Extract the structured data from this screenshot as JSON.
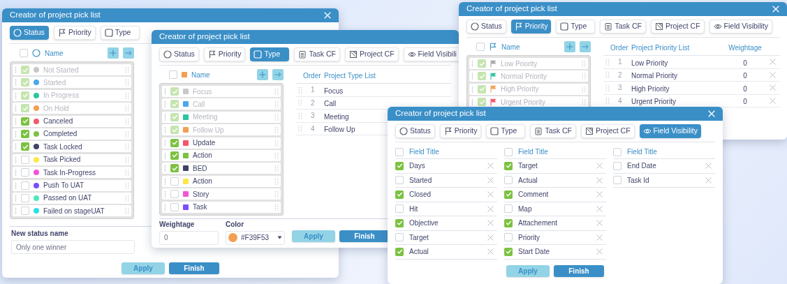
{
  "windows": [
    {
      "kind": "status",
      "title": "Creator of project pick list",
      "closable": true,
      "tabs": [
        {
          "label": "Status",
          "selected": true
        },
        {
          "label": "Priority",
          "selected": false
        },
        {
          "label": "Type",
          "selected": false
        }
      ],
      "list": {
        "all_checked": false,
        "header": "Name",
        "items": [
          {
            "label": "Not Started",
            "color": "#c8c8c8",
            "checked": true,
            "disabled": true
          },
          {
            "label": "Started",
            "color": "#4aa8e8",
            "checked": true,
            "disabled": true
          },
          {
            "label": "In Progress",
            "color": "#2ec4a0",
            "checked": true,
            "disabled": true
          },
          {
            "label": "On Hold",
            "color": "#f39f53",
            "checked": true,
            "disabled": true
          },
          {
            "label": "Canceled",
            "color": "#f5566a",
            "checked": true,
            "disabled": false
          },
          {
            "label": "Completed",
            "color": "#7cc242",
            "checked": true,
            "disabled": false
          },
          {
            "label": "Task Locked",
            "color": "#3f4369",
            "checked": true,
            "disabled": false
          },
          {
            "label": "Task Picked",
            "color": "#fde74c",
            "checked": false,
            "disabled": false
          },
          {
            "label": "Task In-Progress",
            "color": "#f455d6",
            "checked": false,
            "disabled": false
          },
          {
            "label": "Push To UAT",
            "color": "#7c4dff",
            "checked": false,
            "disabled": false
          },
          {
            "label": "Passed on UAT",
            "color": "#4ee8c0",
            "checked": false,
            "disabled": false
          },
          {
            "label": "Failed on stageUAT",
            "color": "#2ee0e0",
            "checked": false,
            "disabled": false
          }
        ]
      },
      "form": [
        {
          "kind": "text",
          "label": "New status name",
          "value": "Only one winner"
        }
      ],
      "buttons": [
        {
          "label": "Apply",
          "kind": "secondary"
        },
        {
          "label": "Finish",
          "kind": "primary"
        }
      ]
    },
    {
      "kind": "type",
      "title": "Creator of project pick list",
      "closable": false,
      "tabs": [
        {
          "label": "Status",
          "selected": false
        },
        {
          "label": "Priority",
          "selected": false
        },
        {
          "label": "Type",
          "selected": true
        },
        {
          "label": "Task CF",
          "selected": false
        },
        {
          "label": "Project CF",
          "selected": false
        },
        {
          "label": "Field Visibili",
          "selected": false
        }
      ],
      "list": {
        "all_checked": false,
        "header": "Name",
        "items": [
          {
            "label": "Focus",
            "color": "#c8c8c8",
            "checked": true,
            "disabled": true
          },
          {
            "label": "Call",
            "color": "#4aa8e8",
            "checked": true,
            "disabled": true
          },
          {
            "label": "Meeting",
            "color": "#2ec4a0",
            "checked": true,
            "disabled": true
          },
          {
            "label": "Follow Up",
            "color": "#f39f53",
            "checked": true,
            "disabled": true
          },
          {
            "label": "Update",
            "color": "#f5566a",
            "checked": true,
            "disabled": false
          },
          {
            "label": "Action",
            "color": "#7cc242",
            "checked": true,
            "disabled": false
          },
          {
            "label": "BED",
            "color": "#3f4369",
            "checked": true,
            "disabled": false
          },
          {
            "label": "Action",
            "color": "#fde74c",
            "checked": false,
            "disabled": false
          },
          {
            "label": "Story",
            "color": "#f455d6",
            "checked": false,
            "disabled": false
          },
          {
            "label": "Task",
            "color": "#7c4dff",
            "checked": false,
            "disabled": false
          }
        ]
      },
      "table": {
        "columns": [
          "Order",
          "Project Type List"
        ],
        "rows": [
          {
            "cells": [
              "1",
              "Focus"
            ]
          },
          {
            "cells": [
              "2",
              "Call"
            ]
          },
          {
            "cells": [
              "3",
              "Meeting"
            ]
          },
          {
            "cells": [
              "4",
              "Follow Up"
            ]
          }
        ]
      },
      "form": [
        {
          "kind": "text",
          "label": "Weightage",
          "value": "0"
        },
        {
          "kind": "color",
          "label": "Color",
          "value": "#F39F53",
          "color": "#f39f53"
        }
      ],
      "buttons": [
        {
          "label": "Apply",
          "kind": "secondary"
        },
        {
          "label": "Finish",
          "kind": "primary"
        }
      ]
    },
    {
      "kind": "priority",
      "title": "Creator of project pick list",
      "closable": true,
      "tabs": [
        {
          "label": "Status",
          "selected": false
        },
        {
          "label": "Priority",
          "selected": true
        },
        {
          "label": "Type",
          "selected": false
        },
        {
          "label": "Task CF",
          "selected": false
        },
        {
          "label": "Project CF",
          "selected": false
        },
        {
          "label": "Field Visibility",
          "selected": false
        }
      ],
      "list": {
        "all_checked": false,
        "header": "Name",
        "items": [
          {
            "label": "Low Priority",
            "color": "#a8a8a8",
            "checked": true,
            "disabled": true
          },
          {
            "label": "Normal Priority",
            "color": "#2ec4a0",
            "checked": true,
            "disabled": true
          },
          {
            "label": "High Priority",
            "color": "#f39f53",
            "checked": true,
            "disabled": true
          },
          {
            "label": "Urgent Priority",
            "color": "#f5566a",
            "checked": true,
            "disabled": true
          }
        ]
      },
      "table": {
        "columns": [
          "Order",
          "Project Priority List",
          "Weightage"
        ],
        "rows": [
          {
            "cells": [
              "1",
              "Low Priority",
              "0"
            ]
          },
          {
            "cells": [
              "2",
              "Normal Priority",
              "0"
            ]
          },
          {
            "cells": [
              "3",
              "High Priority",
              "0"
            ]
          },
          {
            "cells": [
              "4",
              "Urgent Priority",
              "0"
            ]
          }
        ]
      }
    },
    {
      "kind": "visibility",
      "title": "Creator of project pick list",
      "closable": true,
      "tabs": [
        {
          "label": "Status",
          "selected": false
        },
        {
          "label": "Priority",
          "selected": false
        },
        {
          "label": "Type",
          "selected": false
        },
        {
          "label": "Task CF",
          "selected": false
        },
        {
          "label": "Project CF",
          "selected": false
        },
        {
          "label": "Field Visibility",
          "selected": true
        }
      ],
      "field_columns": [
        {
          "header": "Field Title",
          "all_checked": false,
          "items": [
            {
              "label": "Days",
              "checked": true
            },
            {
              "label": "Started",
              "checked": false
            },
            {
              "label": "Closed",
              "checked": true
            },
            {
              "label": "Hit",
              "checked": false
            },
            {
              "label": "Objective",
              "checked": true
            },
            {
              "label": "Target",
              "checked": false
            },
            {
              "label": "Actual",
              "checked": true
            }
          ]
        },
        {
          "header": "Field Title",
          "all_checked": false,
          "items": [
            {
              "label": "Target",
              "checked": true
            },
            {
              "label": "Actual",
              "checked": false
            },
            {
              "label": "Comment",
              "checked": true
            },
            {
              "label": "Map",
              "checked": false
            },
            {
              "label": "Attachement",
              "checked": true
            },
            {
              "label": "Priority",
              "checked": false
            },
            {
              "label": "Start Date",
              "checked": true
            }
          ]
        },
        {
          "header": "Field Title",
          "all_checked": false,
          "items": [
            {
              "label": "End Date",
              "checked": false
            },
            {
              "label": "Task Id",
              "checked": false
            }
          ]
        }
      ],
      "buttons": [
        {
          "label": "Apply",
          "kind": "secondary"
        },
        {
          "label": "Finish",
          "kind": "primary"
        }
      ]
    }
  ]
}
